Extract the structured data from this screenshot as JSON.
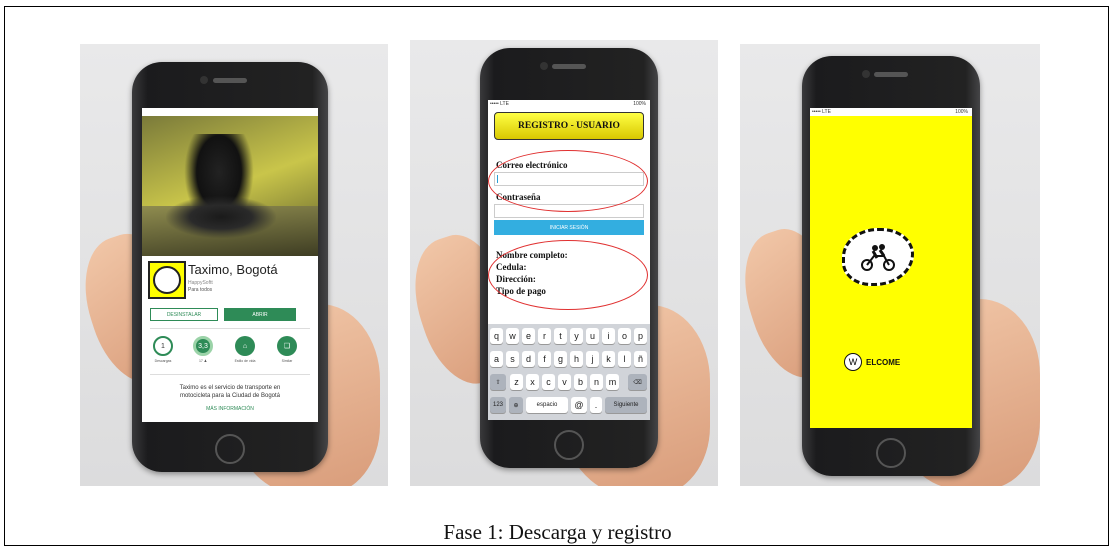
{
  "caption": "Fase 1: Descarga y registro",
  "screen1": {
    "status_carrier": "",
    "app_title": "Taximo, Bogotá",
    "developer": "HappySoftt",
    "rating_note": "Para todos",
    "uninstall_label": "DESINSTALAR",
    "open_label": "ABRIR",
    "stats": [
      {
        "value": "1",
        "label": "Descargas"
      },
      {
        "value": "3,3",
        "label": "17 ♟"
      },
      {
        "value": "⌂",
        "label": "Estilo de vida"
      },
      {
        "value": "❏",
        "label": "Similar"
      }
    ],
    "description_1": "Taximo es el servicio de transporte en",
    "description_2": "motocicleta para la Ciudad  de Bogotá",
    "more_label": "MÁS INFORMACIÓN"
  },
  "screen2": {
    "status_left": "••••• LTE",
    "status_right": "100%",
    "title": "REGISTRO - USUARIO",
    "email_label": "Correo electrónico",
    "password_label": "Contraseña",
    "login_label": "INICIAR SESIÓN",
    "fields": [
      "Nombre completo:",
      "Cedula:",
      "Dirección:",
      "Tipo de pago"
    ],
    "keyboard": {
      "row1": [
        "q",
        "w",
        "e",
        "r",
        "t",
        "y",
        "u",
        "i",
        "o",
        "p"
      ],
      "row2": [
        "a",
        "s",
        "d",
        "f",
        "g",
        "h",
        "j",
        "k",
        "l",
        "ñ"
      ],
      "row3": [
        "z",
        "x",
        "c",
        "v",
        "b",
        "n",
        "m"
      ],
      "num_key": "123",
      "space_key": "espacio",
      "at_key": "@",
      "dot_key": ".",
      "next_key": "Siguiente"
    }
  },
  "screen3": {
    "status_left": "••••• LTE",
    "status_right": "100%",
    "logo_letter": "W",
    "welcome_text": "ELCOME"
  },
  "colors": {
    "accent_yellow": "#ffff00",
    "play_green": "#2e8b57",
    "login_blue": "#33aee0",
    "oval_red": "#e03030"
  }
}
